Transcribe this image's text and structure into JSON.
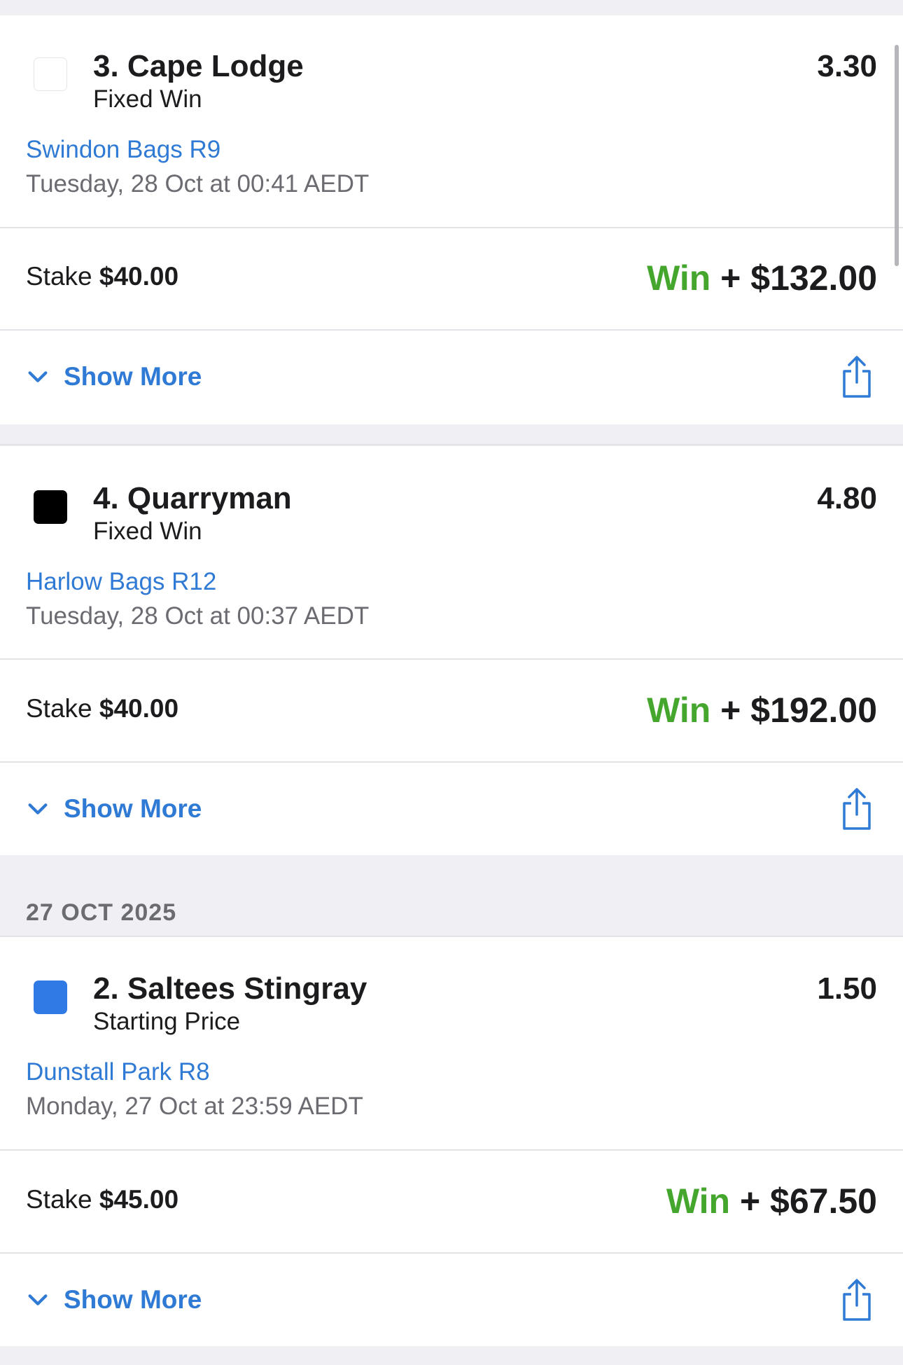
{
  "bets": [
    {
      "silk_color": "#ffffff",
      "runner": "3. Cape Lodge",
      "bet_type": "Fixed Win",
      "odds": "3.30",
      "venue": "Swindon Bags R9",
      "datetime": "Tuesday, 28 Oct at 00:41 AEDT",
      "stake_label": "Stake",
      "stake": "$40.00",
      "result_label": "Win",
      "result_amount": "+ $132.00",
      "show_more": "Show More",
      "share_icon": "share-icon"
    },
    {
      "silk_color": "#000000",
      "runner": "4. Quarryman",
      "bet_type": "Fixed Win",
      "odds": "4.80",
      "venue": "Harlow Bags R12",
      "datetime": "Tuesday, 28 Oct at 00:37 AEDT",
      "stake_label": "Stake",
      "stake": "$40.00",
      "result_label": "Win",
      "result_amount": "+ $192.00",
      "show_more": "Show More",
      "share_icon": "share-icon"
    },
    {
      "silk_color": "#2f7ae5",
      "runner": "2. Saltees Stingray",
      "bet_type": "Starting Price",
      "odds": "1.50",
      "venue": "Dunstall Park R8",
      "datetime": "Monday, 27 Oct at 23:59 AEDT",
      "stake_label": "Stake",
      "stake": "$45.00",
      "result_label": "Win",
      "result_amount": "+ $67.50",
      "show_more": "Show More",
      "share_icon": "share-icon"
    }
  ],
  "date_header": "27 OCT 2025",
  "colors": {
    "accent": "#2f7ad4",
    "win": "#45a62e",
    "background": "#efeff4"
  }
}
